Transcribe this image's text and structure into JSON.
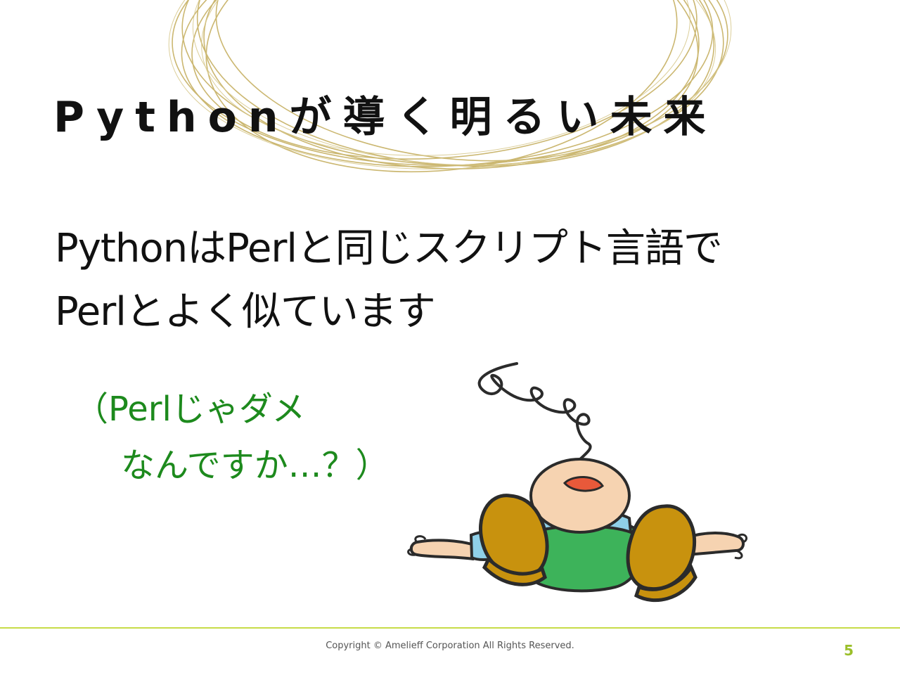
{
  "slide": {
    "title": "Pythonが導く明るい未来",
    "body_lines": [
      "PythonはPerlと同じスクリプト言語で",
      "Perlとよく似ています"
    ],
    "aside_lines": [
      "（Perlじゃダメ",
      "なんですか…？）"
    ],
    "illustration_icon": "fallen-man-illustration",
    "decoration_icon": "gold-rings-decoration"
  },
  "footer": {
    "copyright": "Copyright © Amelieff Corporation All Rights Reserved.",
    "page_number": "5"
  },
  "colors": {
    "title_text": "#111111",
    "aside_text": "#1d8a1d",
    "footer_rule": "#c7dc48",
    "page_number": "#9bbf2a",
    "ring_gold": "#c9b46a"
  }
}
